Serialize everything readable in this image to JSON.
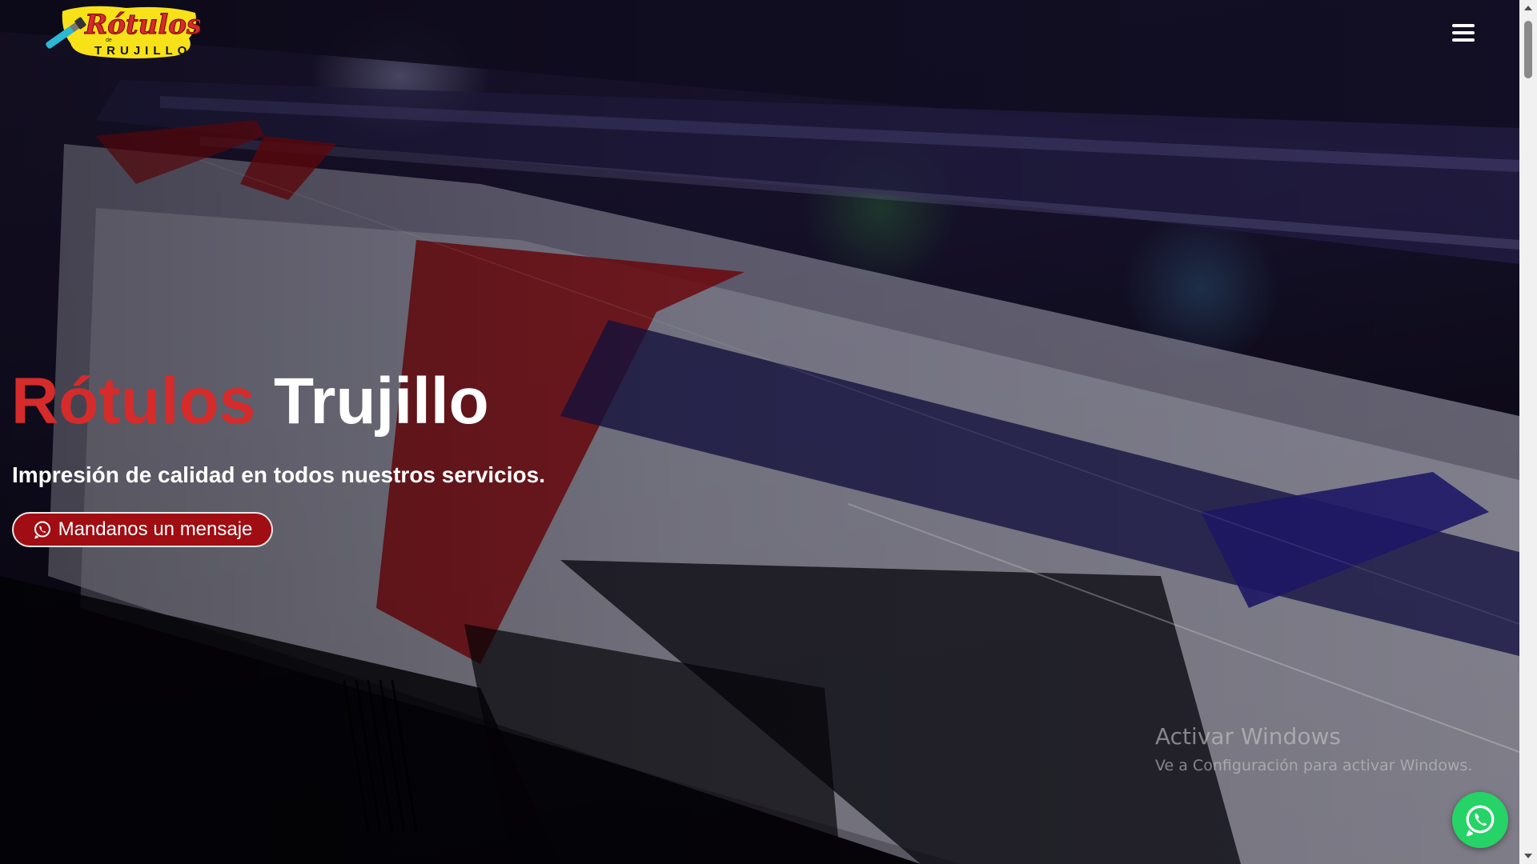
{
  "navbar": {
    "logo": {
      "main_text": "Rótulos",
      "small_text": "de",
      "sub_text": "TRUJILLO"
    },
    "menu_icon": "hamburger-menu-icon"
  },
  "hero": {
    "title_red": "Rótulos",
    "title_white": "Trujillo",
    "subtitle": "Impresión de calidad en todos nuestros servicios.",
    "cta_label": "Mandanos un mensaje",
    "cta_icon": "whatsapp-icon"
  },
  "windows_watermark": {
    "title": "Activar Windows",
    "subtitle": "Ve a Configuración para activar Windows."
  },
  "floating_button": {
    "icon": "whatsapp-icon"
  },
  "colors": {
    "brand_red": "#d52b2b",
    "cta_background": "#a00d12",
    "whatsapp_green": "#25d366",
    "logo_yellow": "#f7e21a"
  }
}
